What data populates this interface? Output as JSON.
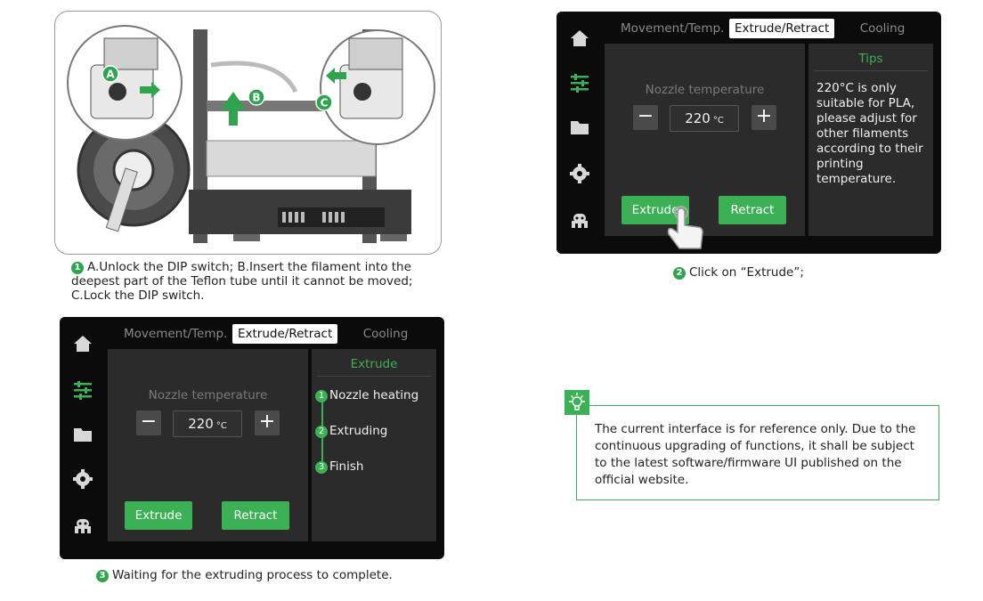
{
  "steps": [
    {
      "num": "1",
      "text": "A.Unlock the DIP switch; B.Insert the filament into the deepest part of the Teflon tube until it cannot be moved; C.Lock the DIP switch."
    },
    {
      "num": "2",
      "text": "Click on “Extrude”;"
    },
    {
      "num": "3",
      "text": "Waiting for the extruding process to complete."
    }
  ],
  "illustration": {
    "callouts": [
      "A",
      "B",
      "C"
    ],
    "accent_color": "#2ea44f"
  },
  "screen_common": {
    "tabs": [
      "Movement/Temp.",
      "Extrude/Retract",
      "Cooling"
    ],
    "active_tab": "Extrude/Retract",
    "sidebar_icons": [
      "home-icon",
      "sliders-icon",
      "folder-icon",
      "gear-icon",
      "robot-icon"
    ],
    "nozzle_label": "Nozzle temperature",
    "temp_value": "220",
    "temp_unit": "°C",
    "minus": "−",
    "plus": "+",
    "extrude_label": "Extrude",
    "retract_label": "Retract",
    "accent": "#3cb054"
  },
  "screen_top": {
    "tips_title": "Tips",
    "tips_lines": [
      "220°C is only",
      "suitable for PLA,",
      "please adjust for",
      "other filaments",
      "according to their",
      "printing",
      "temperature."
    ]
  },
  "screen_bottom": {
    "panel_title": "Extrude",
    "progress": [
      {
        "num": "1",
        "label": "Nozzle heating"
      },
      {
        "num": "2",
        "label": "Extruding"
      },
      {
        "num": "3",
        "label": "Finish"
      }
    ]
  },
  "note": {
    "text": "The current interface is for reference only. Due to the continuous upgrading of functions, it shall be subject to the latest software/firmware UI published on the official website."
  }
}
